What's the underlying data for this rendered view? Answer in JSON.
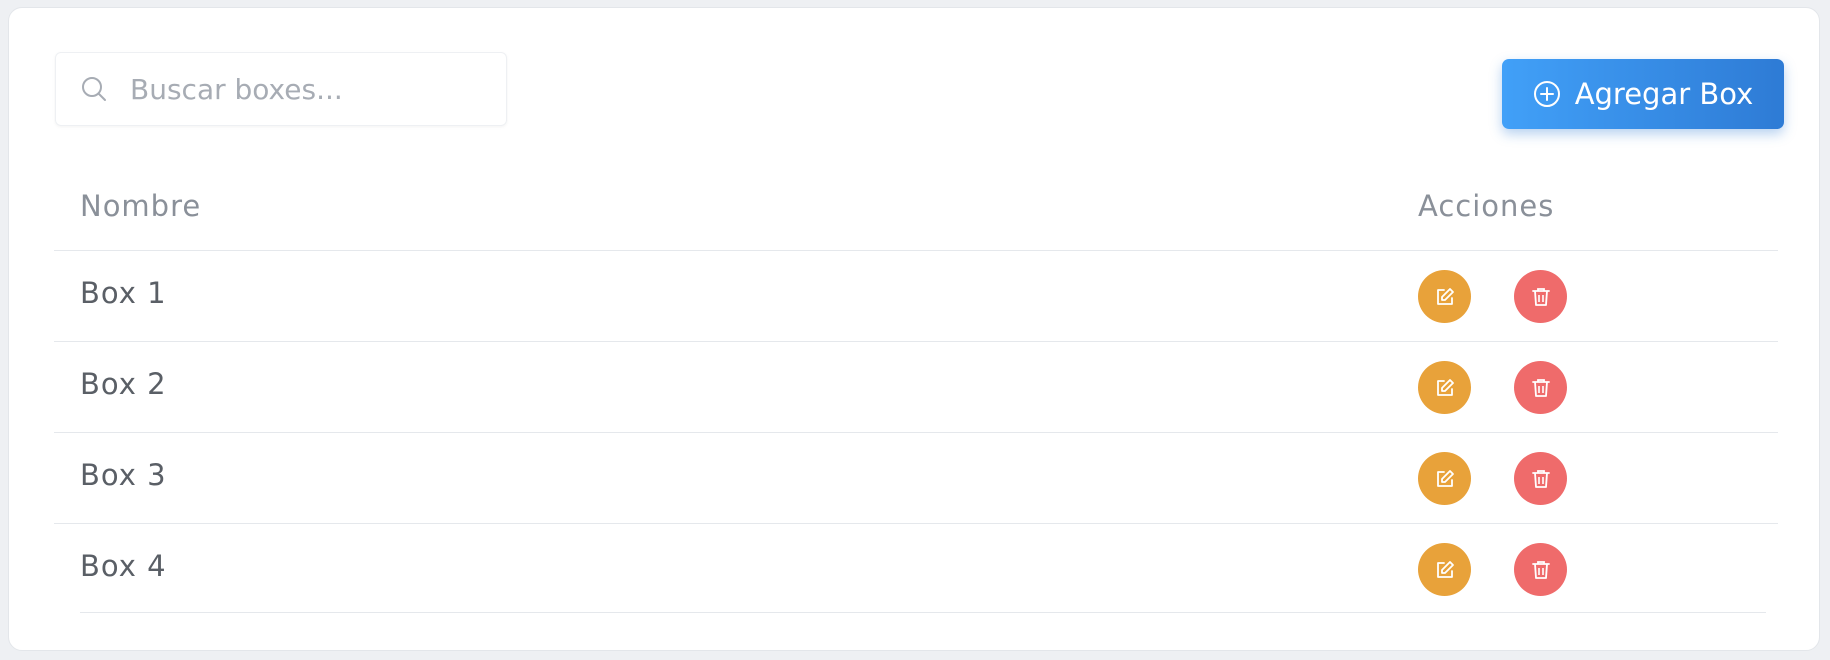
{
  "search": {
    "placeholder": "Buscar boxes..."
  },
  "toolbar": {
    "add_label": "Agregar Box"
  },
  "table": {
    "headers": [
      "Nombre",
      "Acciones"
    ],
    "rows": [
      {
        "name": "Box 1"
      },
      {
        "name": "Box 2"
      },
      {
        "name": "Box 3"
      },
      {
        "name": "Box 4"
      }
    ]
  },
  "icons": {
    "search": "search-icon",
    "add": "plus-circle-icon",
    "edit": "edit-icon",
    "delete": "trash-icon"
  },
  "colors": {
    "primary_start": "#41a0f8",
    "primary_end": "#2e7bd5",
    "edit": "#e8a23a",
    "delete": "#ef6b6b"
  }
}
